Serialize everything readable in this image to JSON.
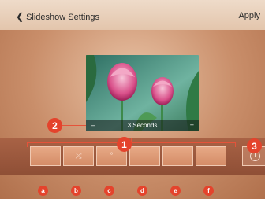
{
  "header": {
    "back_label": "Slideshow Settings",
    "apply_label": "Apply"
  },
  "preview": {
    "duration_label": "3 Seconds",
    "minus": "–",
    "plus": "+"
  },
  "effects": [
    {
      "callout": "a",
      "icon": ""
    },
    {
      "callout": "b",
      "icon": "⤮"
    },
    {
      "callout": "c",
      "icon": "°"
    },
    {
      "callout": "d",
      "icon": ""
    },
    {
      "callout": "e",
      "icon": ""
    },
    {
      "callout": "f",
      "icon": ""
    }
  ],
  "callouts": {
    "one": "1",
    "two": "2",
    "three": "3"
  },
  "colors": {
    "accent": "#e4432c",
    "strip": "#9b573c",
    "header": "#e9d3bf"
  }
}
